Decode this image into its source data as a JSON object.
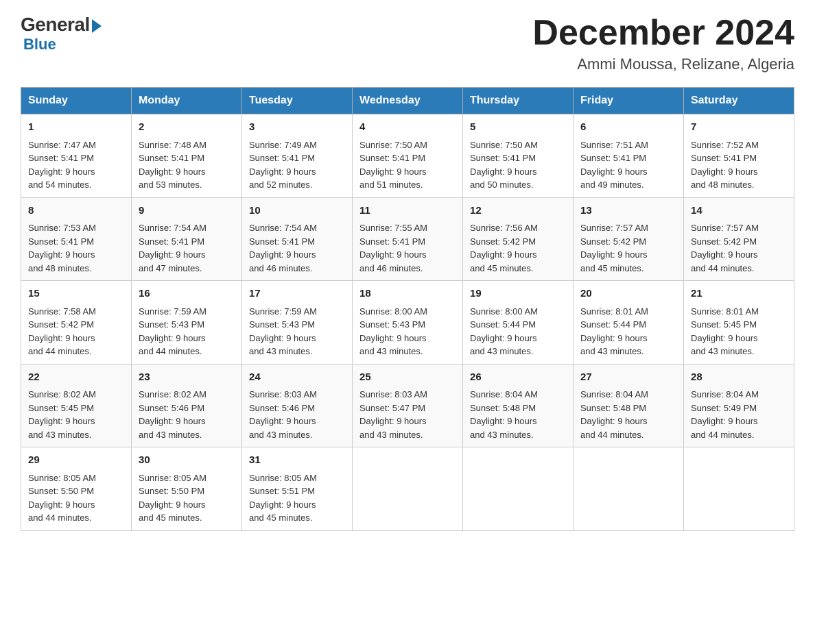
{
  "logo": {
    "general": "General",
    "blue": "Blue"
  },
  "title": "December 2024",
  "location": "Ammi Moussa, Relizane, Algeria",
  "days_of_week": [
    "Sunday",
    "Monday",
    "Tuesday",
    "Wednesday",
    "Thursday",
    "Friday",
    "Saturday"
  ],
  "weeks": [
    [
      {
        "day": "1",
        "sunrise": "7:47 AM",
        "sunset": "5:41 PM",
        "daylight": "9 hours and 54 minutes."
      },
      {
        "day": "2",
        "sunrise": "7:48 AM",
        "sunset": "5:41 PM",
        "daylight": "9 hours and 53 minutes."
      },
      {
        "day": "3",
        "sunrise": "7:49 AM",
        "sunset": "5:41 PM",
        "daylight": "9 hours and 52 minutes."
      },
      {
        "day": "4",
        "sunrise": "7:50 AM",
        "sunset": "5:41 PM",
        "daylight": "9 hours and 51 minutes."
      },
      {
        "day": "5",
        "sunrise": "7:50 AM",
        "sunset": "5:41 PM",
        "daylight": "9 hours and 50 minutes."
      },
      {
        "day": "6",
        "sunrise": "7:51 AM",
        "sunset": "5:41 PM",
        "daylight": "9 hours and 49 minutes."
      },
      {
        "day": "7",
        "sunrise": "7:52 AM",
        "sunset": "5:41 PM",
        "daylight": "9 hours and 48 minutes."
      }
    ],
    [
      {
        "day": "8",
        "sunrise": "7:53 AM",
        "sunset": "5:41 PM",
        "daylight": "9 hours and 48 minutes."
      },
      {
        "day": "9",
        "sunrise": "7:54 AM",
        "sunset": "5:41 PM",
        "daylight": "9 hours and 47 minutes."
      },
      {
        "day": "10",
        "sunrise": "7:54 AM",
        "sunset": "5:41 PM",
        "daylight": "9 hours and 46 minutes."
      },
      {
        "day": "11",
        "sunrise": "7:55 AM",
        "sunset": "5:41 PM",
        "daylight": "9 hours and 46 minutes."
      },
      {
        "day": "12",
        "sunrise": "7:56 AM",
        "sunset": "5:42 PM",
        "daylight": "9 hours and 45 minutes."
      },
      {
        "day": "13",
        "sunrise": "7:57 AM",
        "sunset": "5:42 PM",
        "daylight": "9 hours and 45 minutes."
      },
      {
        "day": "14",
        "sunrise": "7:57 AM",
        "sunset": "5:42 PM",
        "daylight": "9 hours and 44 minutes."
      }
    ],
    [
      {
        "day": "15",
        "sunrise": "7:58 AM",
        "sunset": "5:42 PM",
        "daylight": "9 hours and 44 minutes."
      },
      {
        "day": "16",
        "sunrise": "7:59 AM",
        "sunset": "5:43 PM",
        "daylight": "9 hours and 44 minutes."
      },
      {
        "day": "17",
        "sunrise": "7:59 AM",
        "sunset": "5:43 PM",
        "daylight": "9 hours and 43 minutes."
      },
      {
        "day": "18",
        "sunrise": "8:00 AM",
        "sunset": "5:43 PM",
        "daylight": "9 hours and 43 minutes."
      },
      {
        "day": "19",
        "sunrise": "8:00 AM",
        "sunset": "5:44 PM",
        "daylight": "9 hours and 43 minutes."
      },
      {
        "day": "20",
        "sunrise": "8:01 AM",
        "sunset": "5:44 PM",
        "daylight": "9 hours and 43 minutes."
      },
      {
        "day": "21",
        "sunrise": "8:01 AM",
        "sunset": "5:45 PM",
        "daylight": "9 hours and 43 minutes."
      }
    ],
    [
      {
        "day": "22",
        "sunrise": "8:02 AM",
        "sunset": "5:45 PM",
        "daylight": "9 hours and 43 minutes."
      },
      {
        "day": "23",
        "sunrise": "8:02 AM",
        "sunset": "5:46 PM",
        "daylight": "9 hours and 43 minutes."
      },
      {
        "day": "24",
        "sunrise": "8:03 AM",
        "sunset": "5:46 PM",
        "daylight": "9 hours and 43 minutes."
      },
      {
        "day": "25",
        "sunrise": "8:03 AM",
        "sunset": "5:47 PM",
        "daylight": "9 hours and 43 minutes."
      },
      {
        "day": "26",
        "sunrise": "8:04 AM",
        "sunset": "5:48 PM",
        "daylight": "9 hours and 43 minutes."
      },
      {
        "day": "27",
        "sunrise": "8:04 AM",
        "sunset": "5:48 PM",
        "daylight": "9 hours and 44 minutes."
      },
      {
        "day": "28",
        "sunrise": "8:04 AM",
        "sunset": "5:49 PM",
        "daylight": "9 hours and 44 minutes."
      }
    ],
    [
      {
        "day": "29",
        "sunrise": "8:05 AM",
        "sunset": "5:50 PM",
        "daylight": "9 hours and 44 minutes."
      },
      {
        "day": "30",
        "sunrise": "8:05 AM",
        "sunset": "5:50 PM",
        "daylight": "9 hours and 45 minutes."
      },
      {
        "day": "31",
        "sunrise": "8:05 AM",
        "sunset": "5:51 PM",
        "daylight": "9 hours and 45 minutes."
      },
      null,
      null,
      null,
      null
    ]
  ],
  "labels": {
    "sunrise": "Sunrise:",
    "sunset": "Sunset:",
    "daylight": "Daylight:"
  }
}
